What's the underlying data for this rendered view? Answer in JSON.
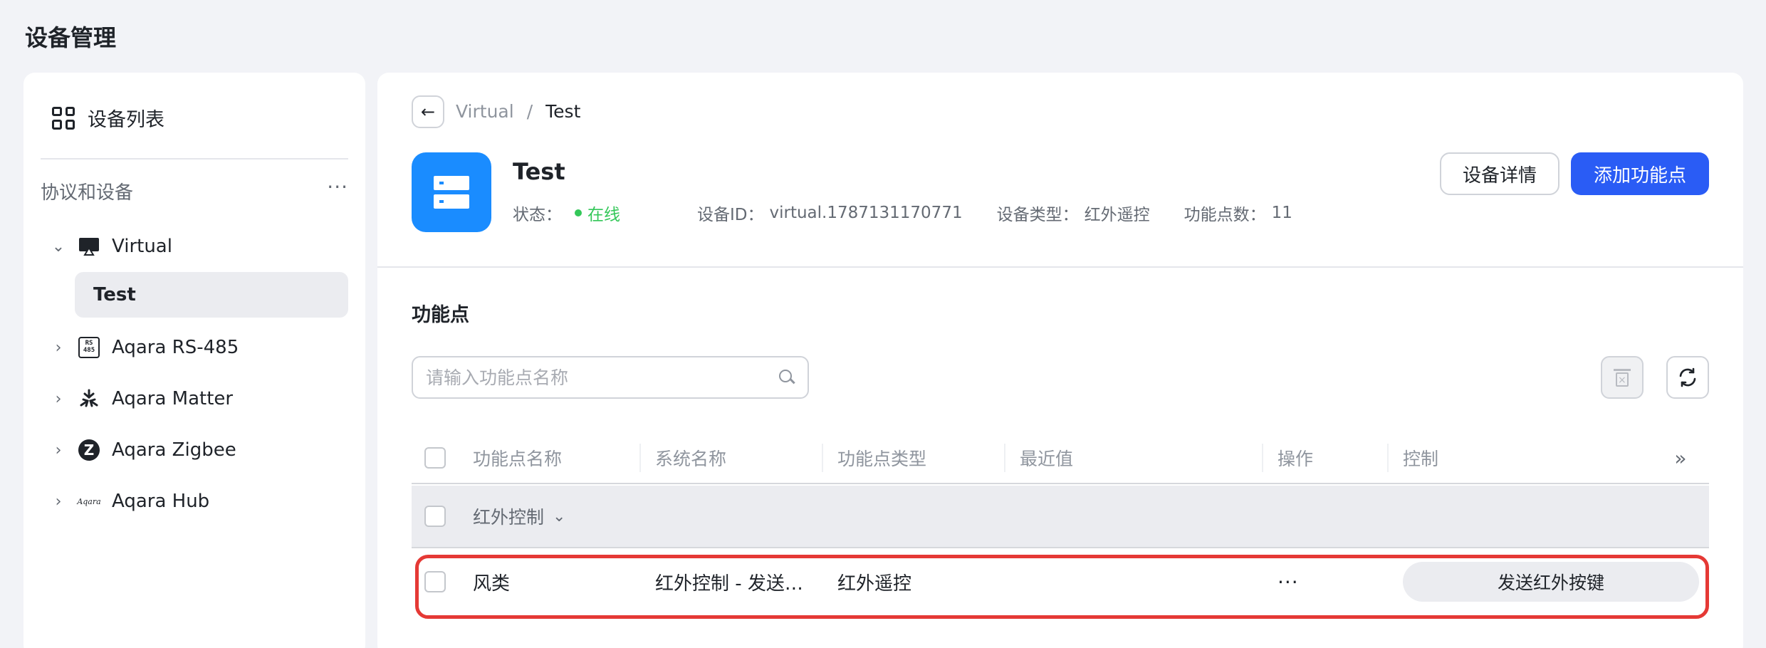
{
  "page_title": "设备管理",
  "sidebar": {
    "list_label": "设备列表",
    "section_title": "协议和设备",
    "more_label": "···",
    "tree": [
      {
        "label": "Virtual",
        "expanded": true,
        "icon": "cast-icon",
        "children": [
          {
            "label": "Test",
            "selected": true
          }
        ]
      },
      {
        "label": "Aqara RS-485",
        "expanded": false,
        "icon": "rs485-icon"
      },
      {
        "label": "Aqara Matter",
        "expanded": false,
        "icon": "matter-icon"
      },
      {
        "label": "Aqara Zigbee",
        "expanded": false,
        "icon": "zigbee-icon"
      },
      {
        "label": "Aqara Hub",
        "expanded": false,
        "icon": "aqara-logo-icon"
      }
    ],
    "rs485_icon_text": "RS\n485",
    "hub_icon_text": "Aqara",
    "zigbee_icon_text": "Z"
  },
  "breadcrumb": {
    "parent": "Virtual",
    "separator": "/",
    "current": "Test"
  },
  "device": {
    "name": "Test",
    "status_label": "状态：",
    "status_value": "在线",
    "status_color": "#34c759",
    "id_label": "设备ID：",
    "id_value": "virtual.1787131170771",
    "type_label": "设备类型：",
    "type_value": "红外遥控",
    "count_label": "功能点数：",
    "count_value": "11"
  },
  "actions": {
    "details": "设备详情",
    "add": "添加功能点"
  },
  "section_title": "功能点",
  "search": {
    "placeholder": "请输入功能点名称",
    "value": ""
  },
  "table": {
    "columns": [
      "功能点名称",
      "系统名称",
      "功能点类型",
      "最近值",
      "操作",
      "控制"
    ],
    "expand_icon": "»",
    "group": {
      "label": "红外控制",
      "expanded": true
    },
    "rows": [
      {
        "name": "风类",
        "system_name": "红外控制 - 发送…",
        "type": "红外遥控",
        "latest": "",
        "op": "···",
        "control": "发送红外按键"
      }
    ]
  },
  "colors": {
    "primary": "#2a5cf5",
    "device_icon_bg": "#1a8cff",
    "highlight_border": "#e53935"
  }
}
